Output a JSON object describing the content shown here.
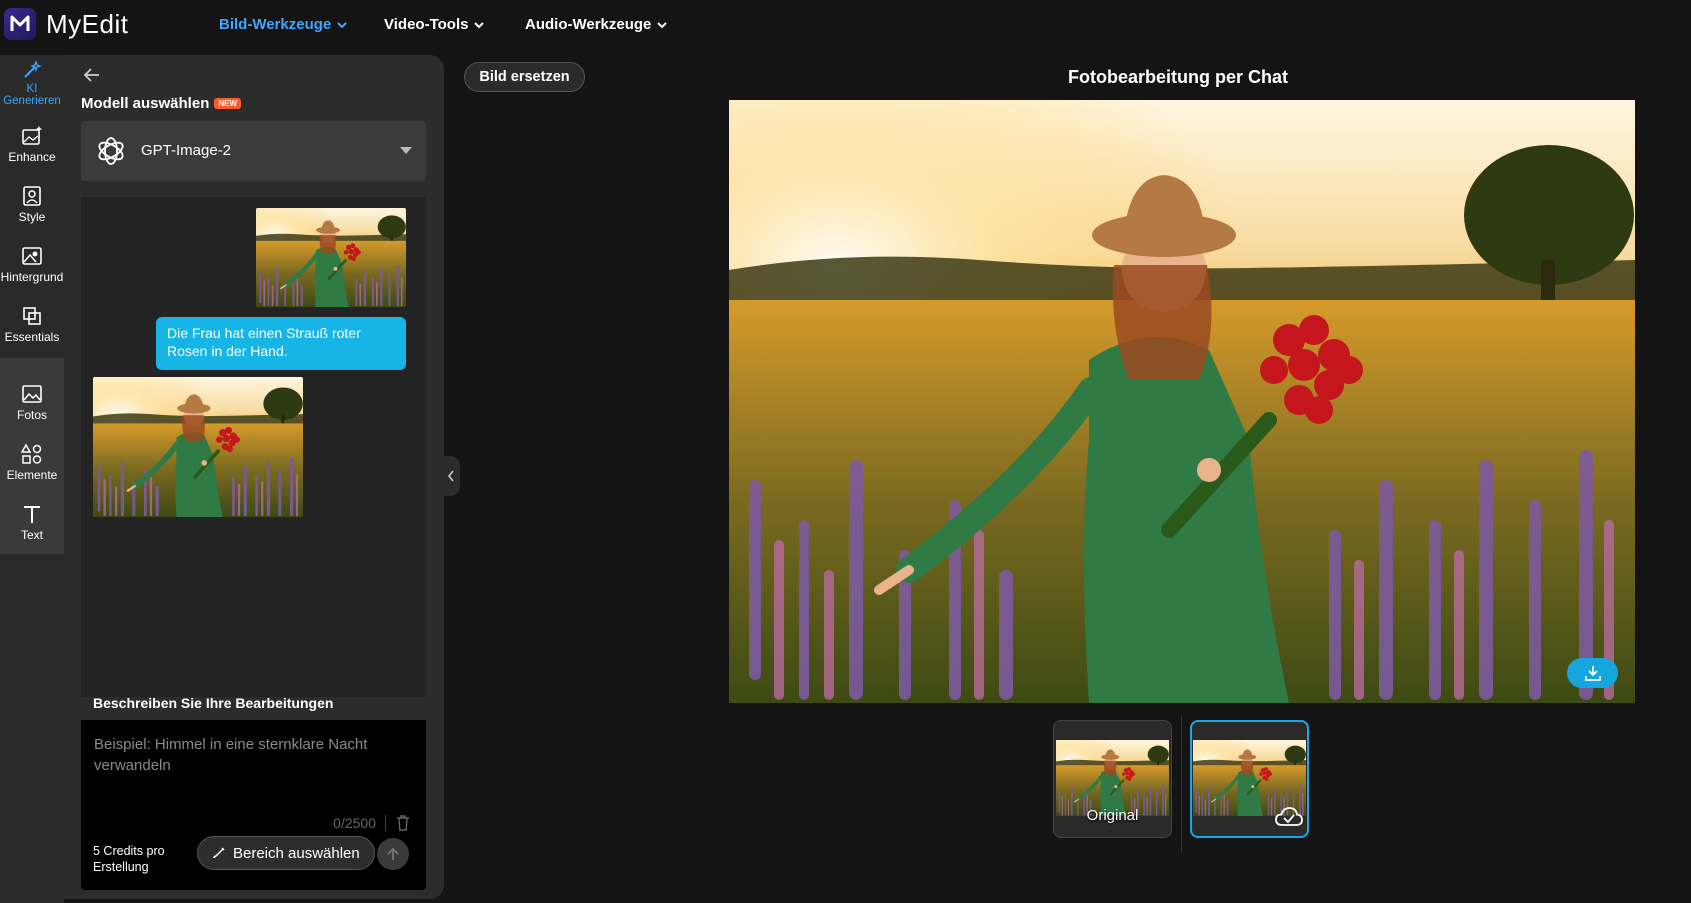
{
  "app": {
    "name": "MyEdit"
  },
  "nav": [
    {
      "label": "Bild-Werkzeuge",
      "active": true
    },
    {
      "label": "Video-Tools",
      "active": false
    },
    {
      "label": "Audio-Werkzeuge",
      "active": false
    }
  ],
  "rail": [
    {
      "label": "KI\nGenerieren",
      "icon": "magic-wand-icon",
      "active": true
    },
    {
      "label": "Enhance",
      "icon": "image-sparkle-icon"
    },
    {
      "label": "Style",
      "icon": "portrait-icon"
    },
    {
      "label": "Hintergrund",
      "icon": "background-icon"
    },
    {
      "label": "Essentials",
      "icon": "layers-icon"
    },
    {
      "label": "Fotos",
      "icon": "photo-icon"
    },
    {
      "label": "Elemente",
      "icon": "shapes-icon"
    },
    {
      "label": "Text",
      "icon": "text-icon"
    }
  ],
  "rail_plus": "+",
  "panel": {
    "model_title": "Modell auswählen",
    "new_badge": "NEW",
    "model_value": "GPT-Image-2",
    "chat_message": "Die Frau hat einen Strauß roter Rosen in der Hand.",
    "prompt_title": "Beschreiben Sie Ihre Bearbeitungen",
    "prompt_placeholder": "Beispiel: Himmel in eine sternklare Nacht verwandeln",
    "counter": "0/2500",
    "credits": "5 Credits pro Erstellung",
    "area_button": "Bereich auswählen"
  },
  "main": {
    "replace_button": "Bild ersetzen",
    "title": "Fotobearbeitung per Chat",
    "thumbnails": [
      {
        "caption": "Original",
        "selected": false
      },
      {
        "caption": "",
        "selected": true
      }
    ]
  },
  "colors": {
    "accent": "#3da6ff",
    "bubble": "#17b4e6",
    "badge": "#ff5a2a"
  }
}
